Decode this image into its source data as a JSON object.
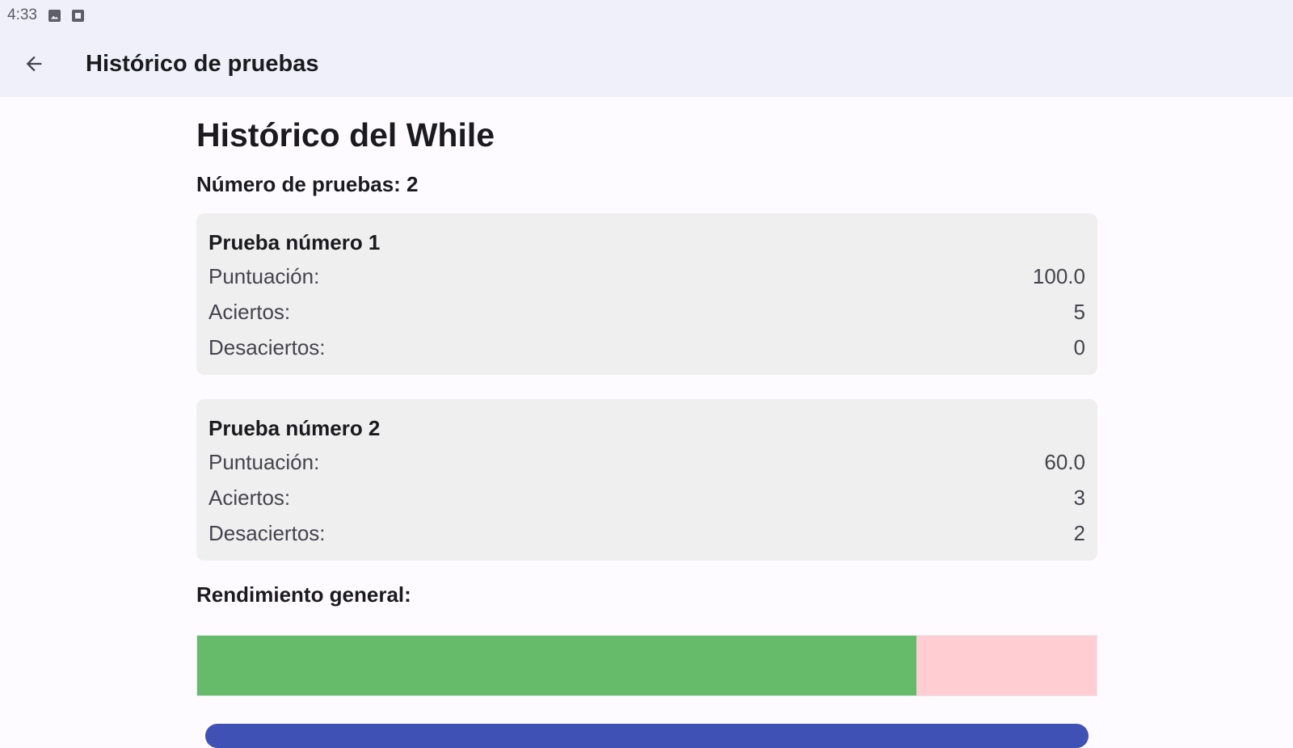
{
  "status_bar": {
    "time": "4:33",
    "icons": [
      "image-icon",
      "box-icon"
    ]
  },
  "app_bar": {
    "title": "Histórico de pruebas",
    "back_icon": "arrow-back-icon"
  },
  "page": {
    "title": "Histórico del While",
    "count_label": "Número de pruebas: 2"
  },
  "tests": [
    {
      "title": "Prueba número 1",
      "rows": [
        {
          "label": "Puntuación:",
          "value": "100.0"
        },
        {
          "label": "Aciertos:",
          "value": "5"
        },
        {
          "label": "Desaciertos:",
          "value": "0"
        }
      ]
    },
    {
      "title": "Prueba número 2",
      "rows": [
        {
          "label": "Puntuación:",
          "value": "60.0"
        },
        {
          "label": "Aciertos:",
          "value": "3"
        },
        {
          "label": "Desaciertos:",
          "value": "2"
        }
      ]
    }
  ],
  "performance": {
    "label": "Rendimiento general:",
    "correct_fraction": 0.8,
    "colors": {
      "correct": "#66bb6a",
      "incorrect": "#ffcdd2"
    }
  },
  "colors": {
    "app_bar_bg": "#f0f0fa",
    "card_bg": "#efefef",
    "button": "#3f51b5"
  }
}
